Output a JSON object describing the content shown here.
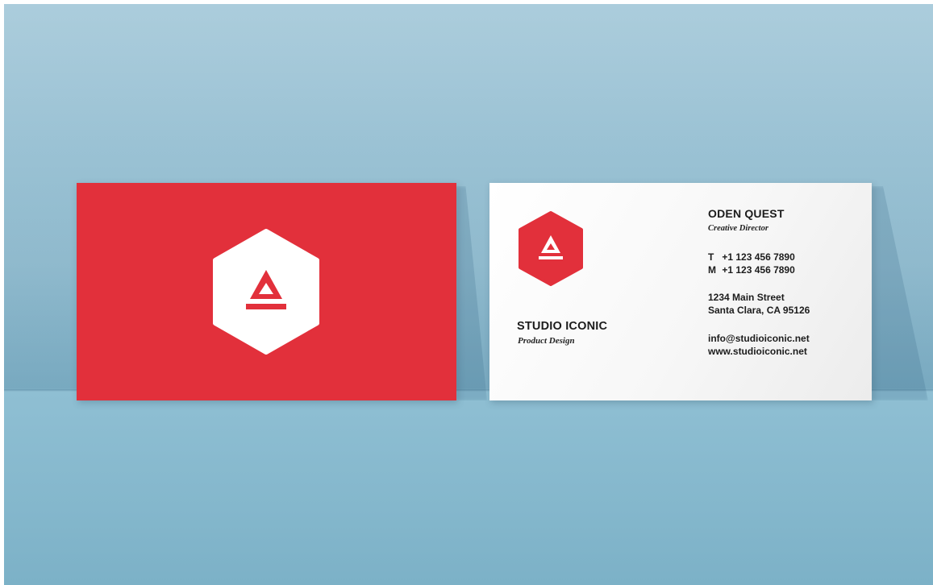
{
  "colors": {
    "brand_red": "#e2303b",
    "card_white": "#ffffff",
    "background_blue": "#93bdd0"
  },
  "logo": {
    "icon": "hexagon-triangle-logo-icon"
  },
  "back_card": {
    "studio_name": "STUDIO ICONIC",
    "studio_tagline": "Product Design",
    "person_name": "ODEN QUEST",
    "person_title": "Creative Director",
    "phone_t_label": "T",
    "phone_t": "+1 123 456 7890",
    "phone_m_label": "M",
    "phone_m": "+1 123 456 7890",
    "address_line1": "1234 Main Street",
    "address_line2": "Santa Clara, CA 95126",
    "email": "info@studioiconic.net",
    "website": "www.studioiconic.net"
  }
}
